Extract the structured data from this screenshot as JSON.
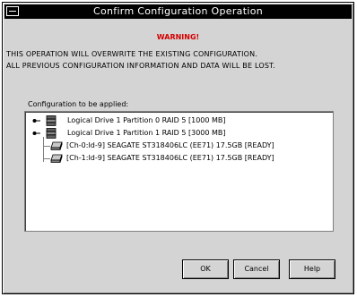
{
  "window": {
    "title": "Confirm Configuration Operation"
  },
  "warning": {
    "heading": "WARNING!",
    "line1": "THIS OPERATION WILL OVERWRITE THE EXISTING CONFIGURATION.",
    "line2": "ALL PREVIOUS CONFIGURATION INFORMATION AND DATA WILL BE LOST."
  },
  "config": {
    "label": "Configuration to be applied:",
    "items": [
      {
        "label": "Logical Drive 1 Partition 0 RAID 5 [1000 MB]",
        "icon": "logical-drive-icon",
        "level": 0
      },
      {
        "label": "Logical Drive 1 Partition 1 RAID 5 [3000 MB]",
        "icon": "logical-drive-icon",
        "level": 0
      },
      {
        "label": "[Ch-0:Id-9] SEAGATE ST318406LC (EE71) 17.5GB [READY]",
        "icon": "physical-disk-icon",
        "level": 1
      },
      {
        "label": "[Ch-1:Id-9] SEAGATE ST318406LC (EE71) 17.5GB [READY]",
        "icon": "physical-disk-icon",
        "level": 1
      }
    ]
  },
  "buttons": {
    "ok": "OK",
    "cancel": "Cancel",
    "help": "Help"
  },
  "colors": {
    "titlebar": "#000000",
    "dialog_bg": "#d4d4d4",
    "warning": "#d40000",
    "panel_bg": "#ffffff"
  }
}
